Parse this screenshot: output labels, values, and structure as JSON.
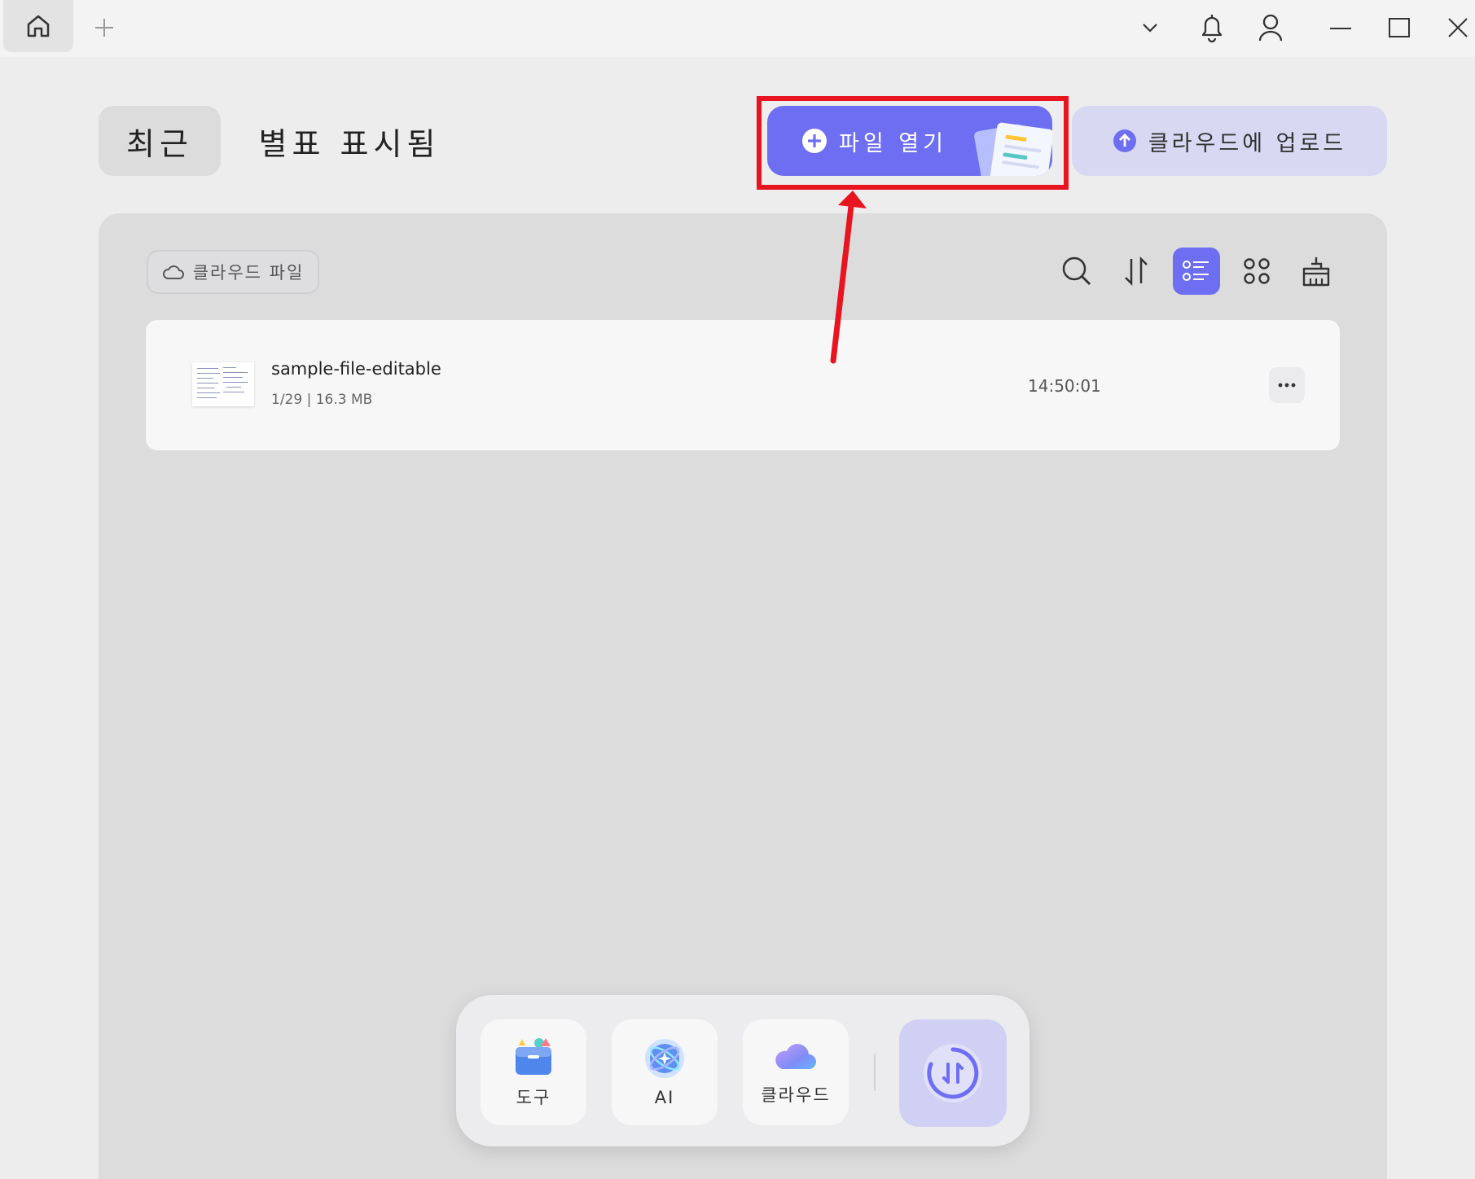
{
  "titlebar": {
    "home_icon": "home-icon",
    "new_tab_icon": "plus-icon",
    "window_icons": [
      "chevron-down-icon",
      "bell-icon",
      "user-icon",
      "minimize-icon",
      "maximize-icon",
      "close-icon"
    ]
  },
  "tabs": {
    "recent": "최근",
    "starred": "별표 표시됨"
  },
  "actions": {
    "open_file": "파일 열기",
    "upload_cloud": "클라우드에 업로드"
  },
  "toolbar": {
    "cloud_files": "클라우드 파일",
    "icons": [
      "search-icon",
      "sort-icon",
      "list-view-icon",
      "grid-view-icon",
      "clean-icon"
    ]
  },
  "files": [
    {
      "name": "sample-file-editable",
      "meta": "1/29 | 16.3 MB",
      "time": "14:50:01"
    }
  ],
  "dock": {
    "tools": "도구",
    "ai": "AI",
    "cloud": "클라우드"
  },
  "colors": {
    "accent": "#6e6ef2",
    "highlight": "#e8141f",
    "upload_bg": "#d8d8f3"
  }
}
